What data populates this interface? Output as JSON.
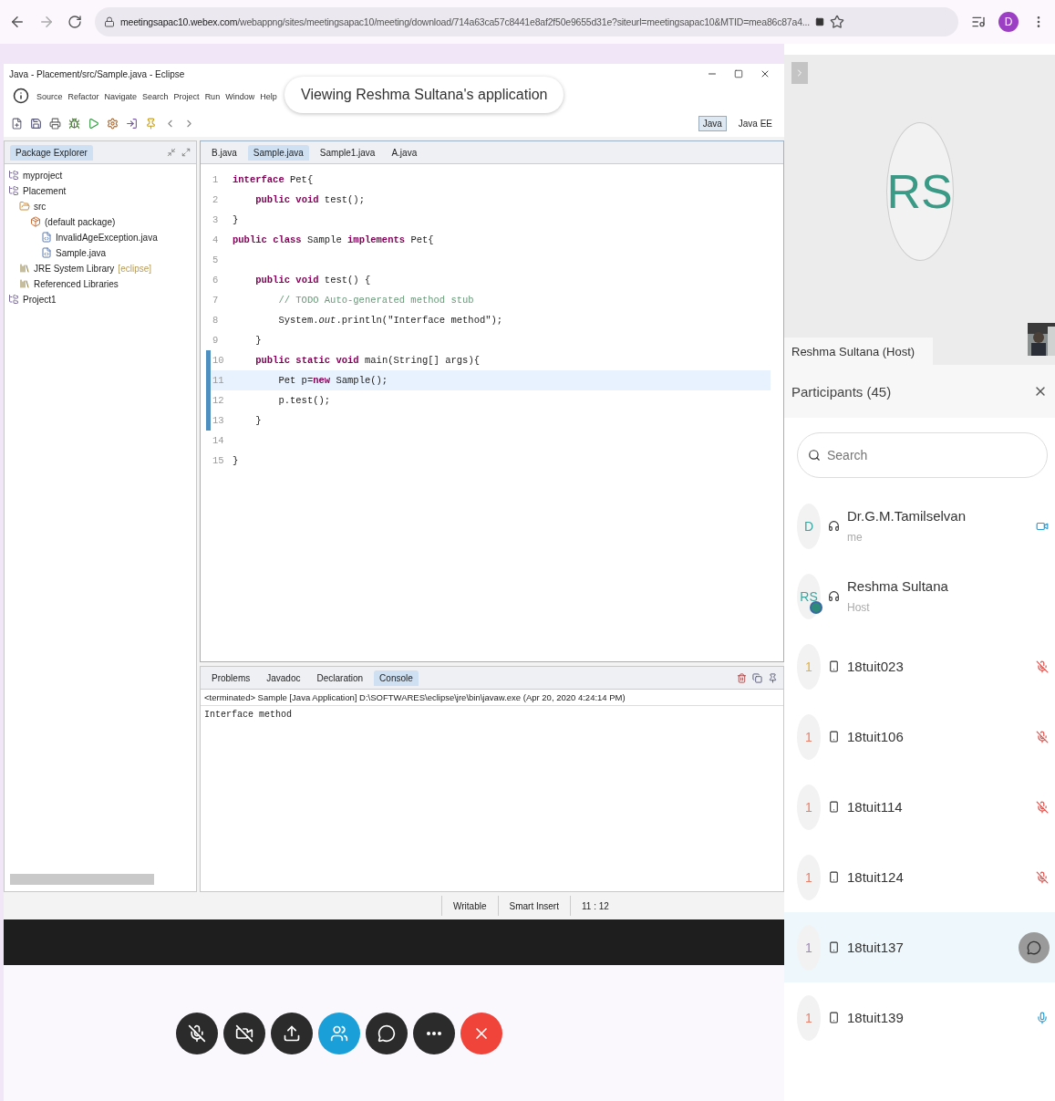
{
  "browser": {
    "url_host": "meetingsapac10.webex.com",
    "url_path": "/webappng/sites/meetingsapac10/meeting/download/714a63ca57c8441e8af2f50e9655d31e?siteurl=meetingsapac10&MTID=mea86c87a4...",
    "profile_initial": "D"
  },
  "eclipse": {
    "title": "Java - Placement/src/Sample.java - Eclipse",
    "menu": [
      "Source",
      "Refactor",
      "Navigate",
      "Search",
      "Project",
      "Run",
      "Window",
      "Help"
    ],
    "sharing_banner": "Viewing Reshma Sultana's application",
    "perspectives": [
      {
        "label": "Java",
        "selected": true
      },
      {
        "label": "Java EE",
        "selected": false
      }
    ],
    "explorer": {
      "title": "Package Explorer",
      "tree": [
        {
          "label": "myproject",
          "kind": "project"
        },
        {
          "label": "Placement",
          "kind": "project",
          "children": [
            {
              "label": "src",
              "kind": "folder",
              "children": [
                {
                  "label": "(default package)",
                  "kind": "package",
                  "children": [
                    {
                      "label": "InvalidAgeException.java",
                      "kind": "file"
                    },
                    {
                      "label": "Sample.java",
                      "kind": "file"
                    }
                  ]
                }
              ]
            },
            {
              "label": "JRE System Library",
              "suffix": "[eclipse]",
              "kind": "library"
            },
            {
              "label": "Referenced Libraries",
              "kind": "library"
            }
          ]
        },
        {
          "label": "Project1",
          "kind": "project"
        }
      ]
    },
    "editor": {
      "tabs": [
        {
          "label": "B.java",
          "selected": false
        },
        {
          "label": "Sample.java",
          "selected": true
        },
        {
          "label": "Sample1.java",
          "selected": false
        },
        {
          "label": "A.java",
          "selected": false
        }
      ],
      "lines": [
        {
          "number": "1",
          "text": "**interface** Pet{",
          "kind": "code",
          "selected": false,
          "marked": false
        },
        {
          "number": "2",
          "text": "    **public** **void** test();",
          "kind": "code",
          "selected": false,
          "marked": false
        },
        {
          "number": "3",
          "text": "}",
          "kind": "code",
          "selected": false,
          "marked": false
        },
        {
          "number": "4",
          "text": "**public** **class** Sample **implements** Pet{",
          "kind": "code",
          "selected": false,
          "marked": false
        },
        {
          "number": "5",
          "selected": false,
          "marked": false
        },
        {
          "number": "6",
          "text": "    **public** **void** test() {",
          "kind": "code",
          "selected": false,
          "marked": false
        },
        {
          "number": "7",
          "text": "        // TODO Auto-generated method stub",
          "kind": "comment",
          "selected": false,
          "marked": false
        },
        {
          "number": "8",
          "text": "        System.*out*.println(\"Interface method\");",
          "kind": "code",
          "selected": false,
          "marked": false
        },
        {
          "number": "9",
          "text": "    }",
          "kind": "code",
          "selected": false,
          "marked": false
        },
        {
          "number": "10",
          "text": "    **public** **static** **void** main(String[] args){",
          "kind": "code",
          "selected": false,
          "marked": true
        },
        {
          "number": "11",
          "text": "        Pet p=**new** Sample();",
          "kind": "code",
          "selected": true,
          "marked": true
        },
        {
          "number": "12",
          "text": "        p.test();",
          "kind": "code",
          "selected": false,
          "marked": true
        },
        {
          "number": "13",
          "text": "    }",
          "kind": "code",
          "selected": false,
          "marked": true
        },
        {
          "number": "14",
          "selected": false,
          "marked": false
        },
        {
          "number": "15",
          "text": "}",
          "kind": "code",
          "selected": false,
          "marked": false
        }
      ]
    },
    "console": {
      "tabs": [
        {
          "label": "Problems",
          "selected": false
        },
        {
          "label": "Javadoc",
          "selected": false
        },
        {
          "label": "Declaration",
          "selected": false
        },
        {
          "label": "Console",
          "selected": true
        }
      ],
      "header": "<terminated> Sample [Java Application] D:\\SOFTWARES\\eclipse\\jre\\bin\\javaw.exe (Apr 20, 2020 4:24:14 PM)",
      "output": "Interface method"
    },
    "status_bar": [
      "Writable",
      "Smart Insert",
      "11 : 12"
    ]
  },
  "video": {
    "initials": "RS",
    "name": "Reshma Sultana (Host)"
  },
  "participants": {
    "title": "Participants (45)",
    "search_placeholder": "Search",
    "items": [
      {
        "initials": "D",
        "color": "#3aa6a0",
        "device": {
          "kind": "headset"
        },
        "name": "Dr.G.M.Tamilselvan",
        "role": "me",
        "status": {
          "kind": "video"
        },
        "presenting": false,
        "selected": false
      },
      {
        "initials": "RS",
        "color": "#3aa6a0",
        "device": {
          "kind": "headset"
        },
        "name": "Reshma Sultana",
        "role": "Host",
        "status": {
          "kind": "idle"
        },
        "presenting": true,
        "selected": false
      },
      {
        "initials": "1",
        "color": "#e0b040",
        "device": {
          "kind": "phone"
        },
        "name": "18tuit023",
        "status": {
          "kind": "muted"
        },
        "presenting": false,
        "selected": false
      },
      {
        "initials": "1",
        "color": "#e8806a",
        "device": {
          "kind": "phone"
        },
        "name": "18tuit106",
        "status": {
          "kind": "muted"
        },
        "presenting": false,
        "selected": false
      },
      {
        "initials": "1",
        "color": "#e8806a",
        "device": {
          "kind": "phone"
        },
        "name": "18tuit114",
        "status": {
          "kind": "muted"
        },
        "presenting": false,
        "selected": false
      },
      {
        "initials": "1",
        "color": "#e8806a",
        "device": {
          "kind": "phone"
        },
        "name": "18tuit124",
        "status": {
          "kind": "muted"
        },
        "presenting": false,
        "selected": false
      },
      {
        "initials": "1",
        "color": "#a088b8",
        "device": {
          "kind": "phone"
        },
        "name": "18tuit137",
        "status": {
          "kind": "chat"
        },
        "presenting": false,
        "selected": true
      },
      {
        "initials": "1",
        "color": "#e8806a",
        "device": {
          "kind": "phone"
        },
        "name": "18tuit139",
        "status": {
          "kind": "mic"
        },
        "presenting": false,
        "selected": false
      }
    ]
  },
  "controls": [
    {
      "kind": "mute",
      "selected": false
    },
    {
      "kind": "video",
      "selected": false
    },
    {
      "kind": "share",
      "selected": false
    },
    {
      "kind": "participants",
      "selected": true
    },
    {
      "kind": "chat",
      "selected": false
    },
    {
      "kind": "more",
      "selected": false
    },
    {
      "kind": "leave",
      "selected": false
    }
  ]
}
